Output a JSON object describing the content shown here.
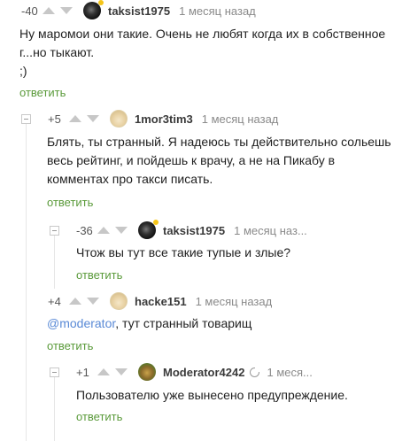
{
  "comments": [
    {
      "rating": "-40",
      "username": "taksist1975",
      "time": "1 месяц назад",
      "lines": [
        "Ну маромои они такие. Очень не любят когда их в собственное",
        "г...но тыкают.",
        ";)"
      ],
      "reply": "ответить"
    },
    {
      "rating": "+5",
      "username": "1mor3tim3",
      "time": "1 месяц назад",
      "lines": [
        "Блять, ты странный. Я надеюсь ты действительно сольешь",
        "весь рейтинг, и пойдешь к врачу, а не на Пикабу в",
        "комментах про такси писать."
      ],
      "reply": "ответить"
    },
    {
      "rating": "-36",
      "username": "taksist1975",
      "time": "1 месяц наз...",
      "lines": [
        "Чтож вы тут все такие тупые и злые?"
      ],
      "reply": "ответить"
    },
    {
      "rating": "+4",
      "username": "hacke151",
      "time": "1 месяц назад",
      "mention": "@moderator",
      "lines": [
        ", тут странный товарищ"
      ],
      "reply": "ответить"
    },
    {
      "rating": "+1",
      "username": "Moderator4242",
      "time": "1 меся...",
      "lines": [
        "Пользователю уже вынесено предупреждение."
      ],
      "reply": "ответить"
    }
  ],
  "colors": {
    "reply": "#5a9a3a",
    "mention": "#5a8ad6",
    "online": "#f5c518"
  },
  "icons": [
    "collapse-icon",
    "upvote-arrow-icon",
    "downvote-arrow-icon",
    "online-indicator-icon",
    "moderator-badge-icon"
  ]
}
